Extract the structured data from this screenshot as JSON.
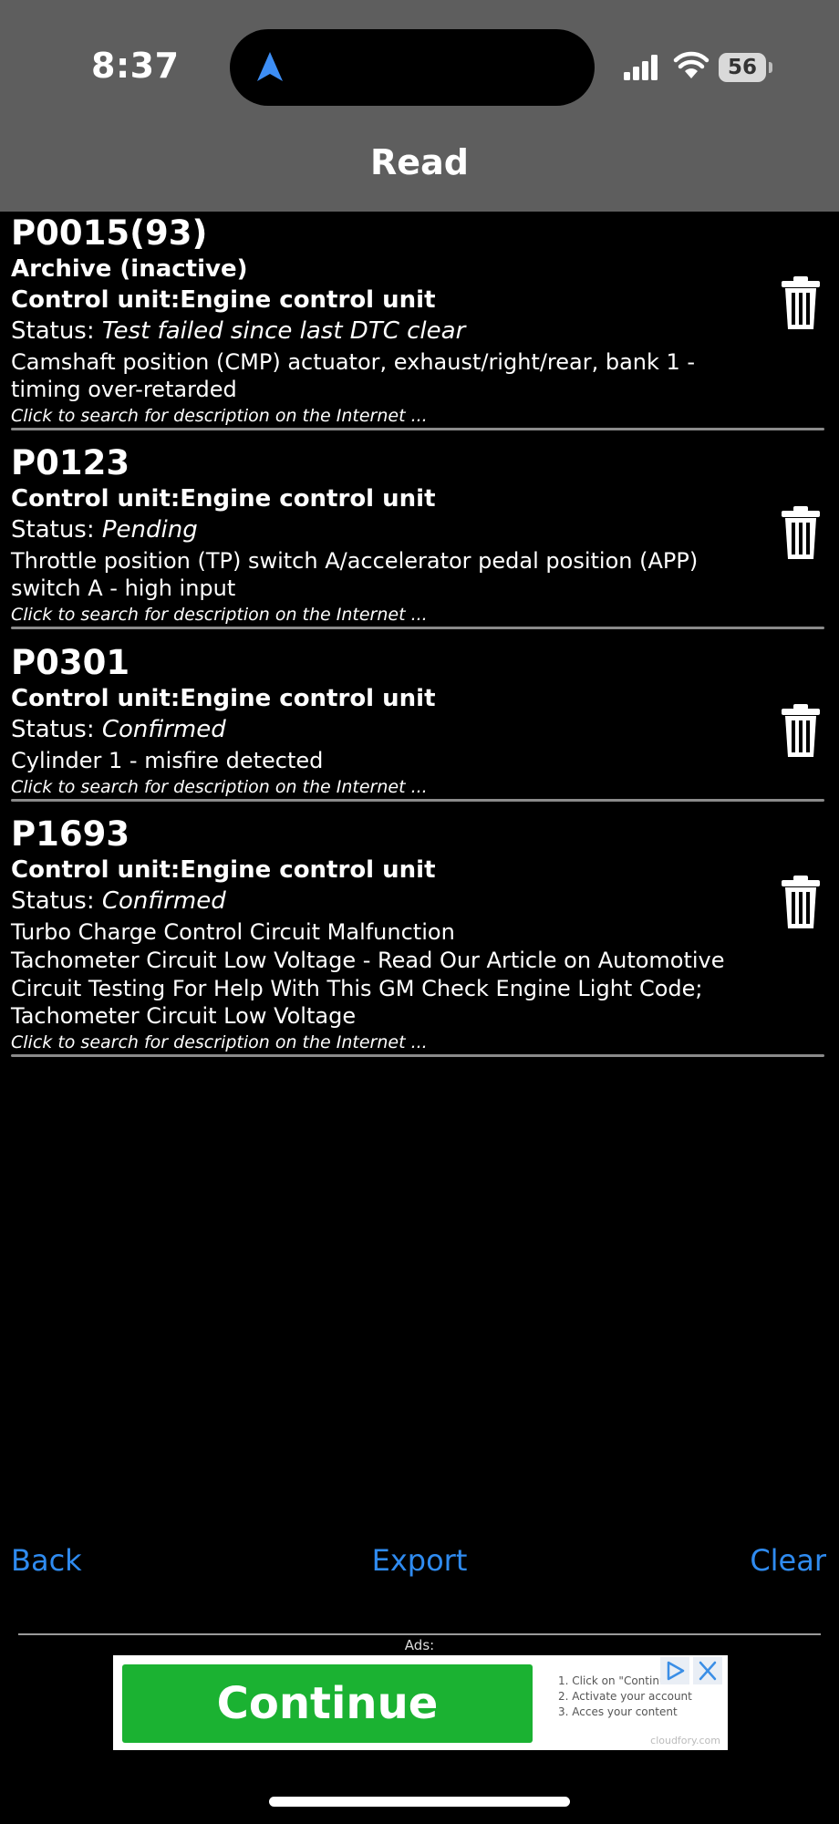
{
  "status_bar": {
    "time": "8:37",
    "battery": "56"
  },
  "title": "Read",
  "search_hint": "Click to search for description on the Internet ...",
  "entries": [
    {
      "code": "P0015(93)",
      "archive": "Archive (inactive)",
      "control_unit": "Control unit:Engine control unit",
      "status_label": "Status: ",
      "status_value": "Test failed since last DTC clear",
      "desc_lines": [
        "Camshaft position (CMP) actuator, exhaust/right/rear, bank 1 -",
        "timing over-retarded"
      ]
    },
    {
      "code": "P0123",
      "control_unit": "Control unit:Engine control unit",
      "status_label": "Status: ",
      "status_value": "Pending",
      "desc_lines": [
        "Throttle position (TP) switch A/accelerator pedal position (APP)",
        "switch A - high input"
      ]
    },
    {
      "code": "P0301",
      "control_unit": "Control unit:Engine control unit",
      "status_label": "Status: ",
      "status_value": "Confirmed",
      "desc_lines": [
        "Cylinder 1 - misfire detected"
      ]
    },
    {
      "code": "P1693",
      "control_unit": "Control unit:Engine control unit",
      "status_label": "Status: ",
      "status_value": "Confirmed",
      "desc_lines": [
        "Turbo Charge Control Circuit Malfunction",
        "Tachometer Circuit Low Voltage - Read Our Article on Automotive",
        "Circuit Testing For Help With This GM Check Engine Light Code;",
        "Tachometer Circuit Low Voltage"
      ]
    }
  ],
  "buttons": {
    "back": "Back",
    "export": "Export",
    "clear": "Clear"
  },
  "ads": {
    "label": "Ads:",
    "continue": "Continue",
    "steps": [
      "1. Click on \"Continu",
      "2. Activate your account",
      "3. Acces your content"
    ],
    "brand": "cloudfory.com"
  },
  "colors": {
    "header_bg": "#5e5e5e",
    "link": "#2f8bf0",
    "ad_green": "#1bb232",
    "divider": "#8a8a8a"
  },
  "icons": [
    "location-arrow-icon",
    "cellular-signal-icon",
    "wifi-icon",
    "battery-icon",
    "trash-icon",
    "ad-play-icon",
    "ad-close-icon"
  ]
}
